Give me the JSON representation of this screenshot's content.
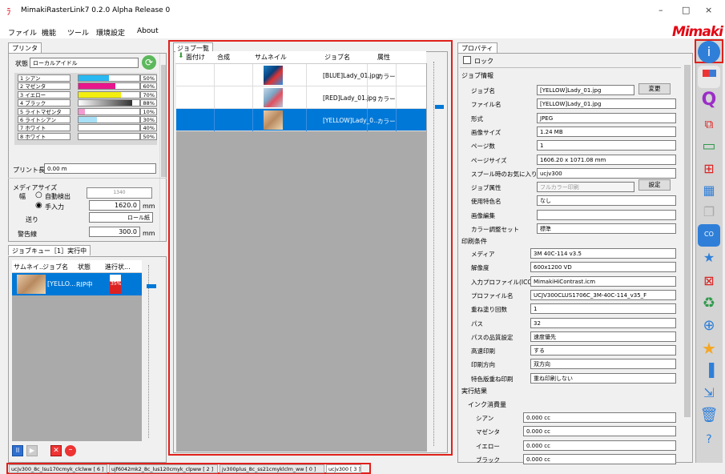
{
  "window": {
    "title": "MimakiRasterLink7 0.2.0 Alpha Release 0",
    "min": "–",
    "max": "□",
    "close": "×",
    "logo": "Mimaki"
  },
  "menu": [
    "ファイル",
    "機能",
    "ツール",
    "環境設定",
    "About"
  ],
  "printer": {
    "tab": "プリンタ",
    "status_label": "状態",
    "status_value": "ローカルアイドル",
    "inks": [
      {
        "name": "1 シアン",
        "pct": "50%",
        "color": "#29b8f0",
        "fill": 0.5
      },
      {
        "name": "2 マゼンタ",
        "pct": "60%",
        "color": "#e8168c",
        "fill": 0.6
      },
      {
        "name": "3 イエロー",
        "pct": "70%",
        "color": "#f3ee10",
        "fill": 0.7
      },
      {
        "name": "4 ブラック",
        "pct": "88%",
        "color": "#333333",
        "fill": 0.88,
        "gradient": true
      },
      {
        "name": "5 ライトマゼンタ",
        "pct": "10%",
        "color": "#f39ad0",
        "fill": 0.1
      },
      {
        "name": "6 ライトシアン",
        "pct": "30%",
        "color": "#a8e0f8",
        "fill": 0.3
      },
      {
        "name": "7 ホワイト",
        "pct": "40%",
        "color": "#ffffff",
        "fill": 0.4
      },
      {
        "name": "8 ホワイト",
        "pct": "50%",
        "color": "#ffffff",
        "fill": 0.5
      }
    ],
    "print_length_label": "プリント長",
    "print_length_value": "0.00 m",
    "media_size_label": "メディアサイズ",
    "width_label": "幅",
    "auto_detect": "自動検出",
    "manual": "手入力",
    "width_value": "1620.0",
    "unit": "mm",
    "media_diagram": "1340",
    "fill_label": "送り",
    "fill_value": "ロール紙",
    "warning_label": "警告線",
    "warning_value": "300.0",
    "warning_unit": "mm"
  },
  "queue": {
    "tab": "ジョブキュー［1］実行中",
    "headers": [
      "サムネイ..",
      "ジョブ名",
      "状態",
      "進行状..."
    ],
    "row": {
      "name": "[YELLO...",
      "state": "RIP中",
      "progress": "35%"
    }
  },
  "jobs": {
    "tab": "ジョブ一覧",
    "headers": [
      "面付け",
      "合成",
      "サムネイル",
      "ジョブ名",
      "属性"
    ],
    "rows": [
      {
        "name": "[BLUE]Lady_01.jpg",
        "attr": "カラー"
      },
      {
        "name": "[RED]Lady_01.jpg",
        "attr": "カラー"
      },
      {
        "name": "[YELLOW]Lady_0...",
        "attr": "カラー"
      }
    ]
  },
  "props": {
    "tab": "プロパティ",
    "lock": "ロック",
    "job_info": "ジョブ情報",
    "fields": [
      {
        "label": "ジョブ名",
        "value": "[YELLOW]Lady_01.jpg"
      },
      {
        "label": "ファイル名",
        "value": "[YELLOW]Lady_01.jpg"
      },
      {
        "label": "形式",
        "value": "JPEG"
      },
      {
        "label": "画像サイズ",
        "value": "1.24 MB"
      },
      {
        "label": "ページ数",
        "value": "1"
      },
      {
        "label": "ページサイズ",
        "value": "1606.20 x 1071.08 mm"
      },
      {
        "label": "スプール時のお気に入り",
        "value": "ucjv300"
      },
      {
        "label": "ジョブ属性",
        "value": "フルカラー印刷"
      },
      {
        "label": "使用特色名",
        "value": "なし"
      },
      {
        "label": "画像編集",
        "value": ""
      },
      {
        "label": "カラー調整セット",
        "value": "標準"
      }
    ],
    "change_btn": "変更",
    "set_btn": "設定",
    "print_cond": "印刷条件",
    "cond": [
      {
        "label": "メディア",
        "value": "3M 40C-114 v3.5"
      },
      {
        "label": "解像度",
        "value": "600x1200 VD"
      },
      {
        "label": "入力プロファイル(ICC)",
        "value": "MimakiHiContrast.icm"
      },
      {
        "label": "プロファイル名",
        "value": "UCJV300CLUS1706C_3M-40C-114_v35_F"
      },
      {
        "label": "重ね塗り回数",
        "value": "1"
      },
      {
        "label": "パス",
        "value": "32"
      },
      {
        "label": "パスの品質設定",
        "value": "速度優先"
      },
      {
        "label": "高速印刷",
        "value": "する"
      },
      {
        "label": "印刷方向",
        "value": "双方向"
      },
      {
        "label": "特色版重ね印刷",
        "value": "重ね印刷しない"
      }
    ],
    "result": "実行結果",
    "ink_usage": "インク消費量",
    "usage": [
      {
        "label": "シアン",
        "value": "0.000 cc"
      },
      {
        "label": "マゼンタ",
        "value": "0.000 cc"
      },
      {
        "label": "イエロー",
        "value": "0.000 cc"
      },
      {
        "label": "ブラック",
        "value": "0.000 cc"
      }
    ]
  },
  "printer_tabs": [
    "ucjv300_8c_lsu170cmyk_clclww [ 6 ]",
    "ujf6042mk2_8c_lus120cmyk_clpww [ 2 ]",
    "jv300plus_8c_ss21cmyklclm_ww [ 0 ]",
    "ucjv300 [ 3 ]"
  ]
}
